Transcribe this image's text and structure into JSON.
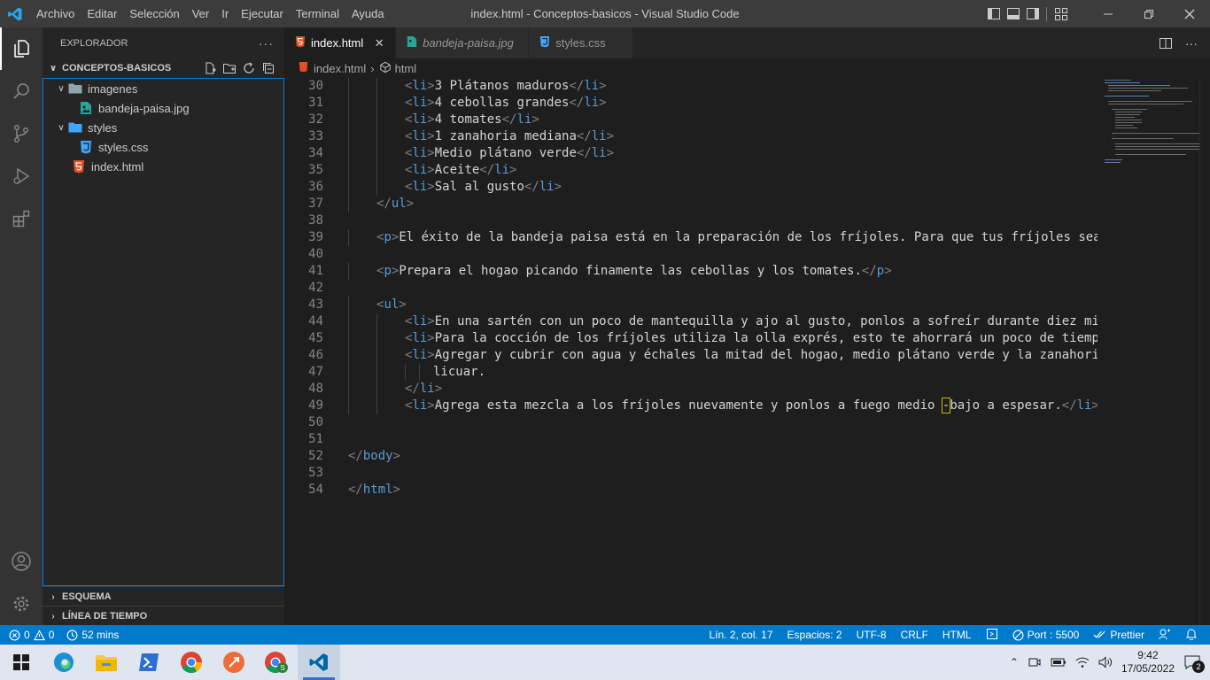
{
  "titlebar": {
    "menu": [
      "Archivo",
      "Editar",
      "Selección",
      "Ver",
      "Ir",
      "Ejecutar",
      "Terminal",
      "Ayuda"
    ],
    "title": "index.html - Conceptos-basicos - Visual Studio Code"
  },
  "sidebar": {
    "header": "EXPLORADOR",
    "root": "CONCEPTOS-BASICOS",
    "tree": [
      {
        "label": "imagenes",
        "type": "folder"
      },
      {
        "label": "bandeja-paisa.jpg",
        "type": "image"
      },
      {
        "label": "styles",
        "type": "folder"
      },
      {
        "label": "styles.css",
        "type": "css"
      },
      {
        "label": "index.html",
        "type": "html"
      }
    ],
    "outline": "ESQUEMA",
    "timeline": "LÍNEA DE TIEMPO"
  },
  "tabs": [
    {
      "label": "index.html",
      "icon": "html-file-icon"
    },
    {
      "label": "bandeja-paisa.jpg",
      "icon": "image-file-icon"
    },
    {
      "label": "styles.css",
      "icon": "css-file-icon"
    }
  ],
  "breadcrumbs": {
    "file": "index.html",
    "symbol": "html"
  },
  "code": {
    "lines": [
      {
        "n": "30",
        "text": "3 Plátanos maduros"
      },
      {
        "n": "31",
        "text": "4 cebollas grandes"
      },
      {
        "n": "32",
        "text": "4 tomates"
      },
      {
        "n": "33",
        "text": "1 zanahoria mediana"
      },
      {
        "n": "34",
        "text": "Medio plátano verde"
      },
      {
        "n": "35",
        "text": "Aceite"
      },
      {
        "n": "36",
        "text": "Sal al gusto"
      },
      {
        "n": "37",
        "text": ""
      },
      {
        "n": "38",
        "text": ""
      },
      {
        "n": "39",
        "text": "El éxito de la bandeja paisa está en la preparación de los fríjoles. Para que tus fríjoles sean m"
      },
      {
        "n": "40",
        "text": ""
      },
      {
        "n": "41",
        "text": "Prepara el hogao picando finamente las cebollas y los tomates."
      },
      {
        "n": "42",
        "text": ""
      },
      {
        "n": "43",
        "text": ""
      },
      {
        "n": "44",
        "text": "En una sartén con un poco de mantequilla y ajo al gusto, ponlos a sofreír durante diez minut"
      },
      {
        "n": "45",
        "text": "Para la cocción de los fríjoles utiliza la olla exprés, esto te ahorrará un poco de tiempo."
      },
      {
        "n": "46",
        "text": "Agregar y cubrir con agua y échales la mitad del hogao, medio plátano verde y la zanahoria m"
      },
      {
        "n": "47",
        "text": "licuar."
      },
      {
        "n": "48",
        "text": ""
      },
      {
        "n": "49",
        "text": "Agrega esta mezcla a los fríjoles nuevamente y ponlos a fuego medio "
      },
      {
        "n": "50",
        "text": ""
      },
      {
        "n": "51",
        "text": ""
      },
      {
        "n": "52",
        "text": ""
      },
      {
        "n": "53",
        "text": ""
      },
      {
        "n": "54",
        "text": ""
      }
    ],
    "line49_cursor_char": "-",
    "line49_tail": "bajo a espesar."
  },
  "statusbar": {
    "problems": "0",
    "warnings": "0",
    "time": "52 mins",
    "position": "Lín. 2, col. 17",
    "spaces": "Espacios: 2",
    "encoding": "UTF-8",
    "eol": "CRLF",
    "language": "HTML",
    "port": "Port : 5500",
    "prettier": "Prettier"
  },
  "taskbar": {
    "time": "9:42",
    "date": "17/05/2022",
    "notifications": "2"
  },
  "colors": {
    "accent": "#007acc",
    "tag": "#569cd6",
    "html_icon": "#e44d26",
    "css_icon": "#42a5f5",
    "image_icon": "#26a69a"
  }
}
